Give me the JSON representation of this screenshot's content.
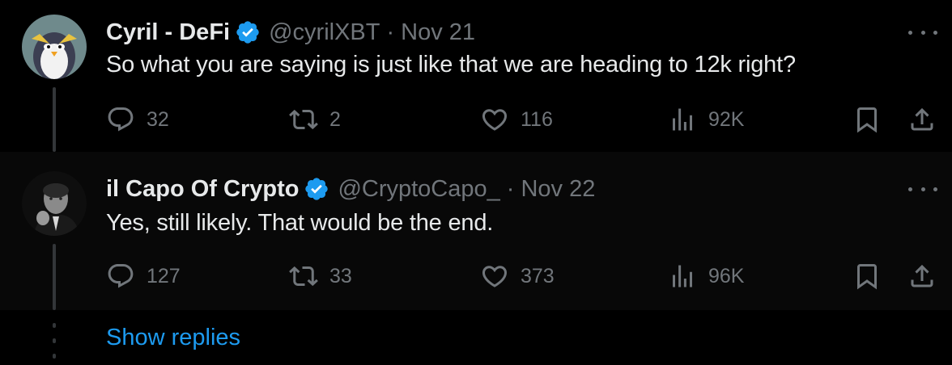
{
  "tweets": [
    {
      "name": "Cyril - DeFi",
      "handle": "@cyrilXBT",
      "dot": "·",
      "date": "Nov 21",
      "text": "So what you are saying is just like that we are heading to 12k right?",
      "replies": "32",
      "retweets": "2",
      "likes": "116",
      "views": "92K"
    },
    {
      "name": "il Capo Of Crypto",
      "handle": "@CryptoCapo_",
      "dot": "·",
      "date": "Nov 22",
      "text": "Yes, still likely. That would be the end.",
      "replies": "127",
      "retweets": "33",
      "likes": "373",
      "views": "96K"
    }
  ],
  "show_replies_label": "Show replies",
  "colors": {
    "background": "#000000",
    "text": "#e7e9ea",
    "secondary": "#71767b",
    "accent": "#1d9bf0",
    "verified": "#1d9bf0"
  },
  "icons": {
    "reply": "reply-icon",
    "retweet": "retweet-icon",
    "like": "heart-icon",
    "views": "views-icon",
    "bookmark": "bookmark-icon",
    "share": "share-icon",
    "more": "more-icon",
    "verified": "verified-badge-icon"
  }
}
